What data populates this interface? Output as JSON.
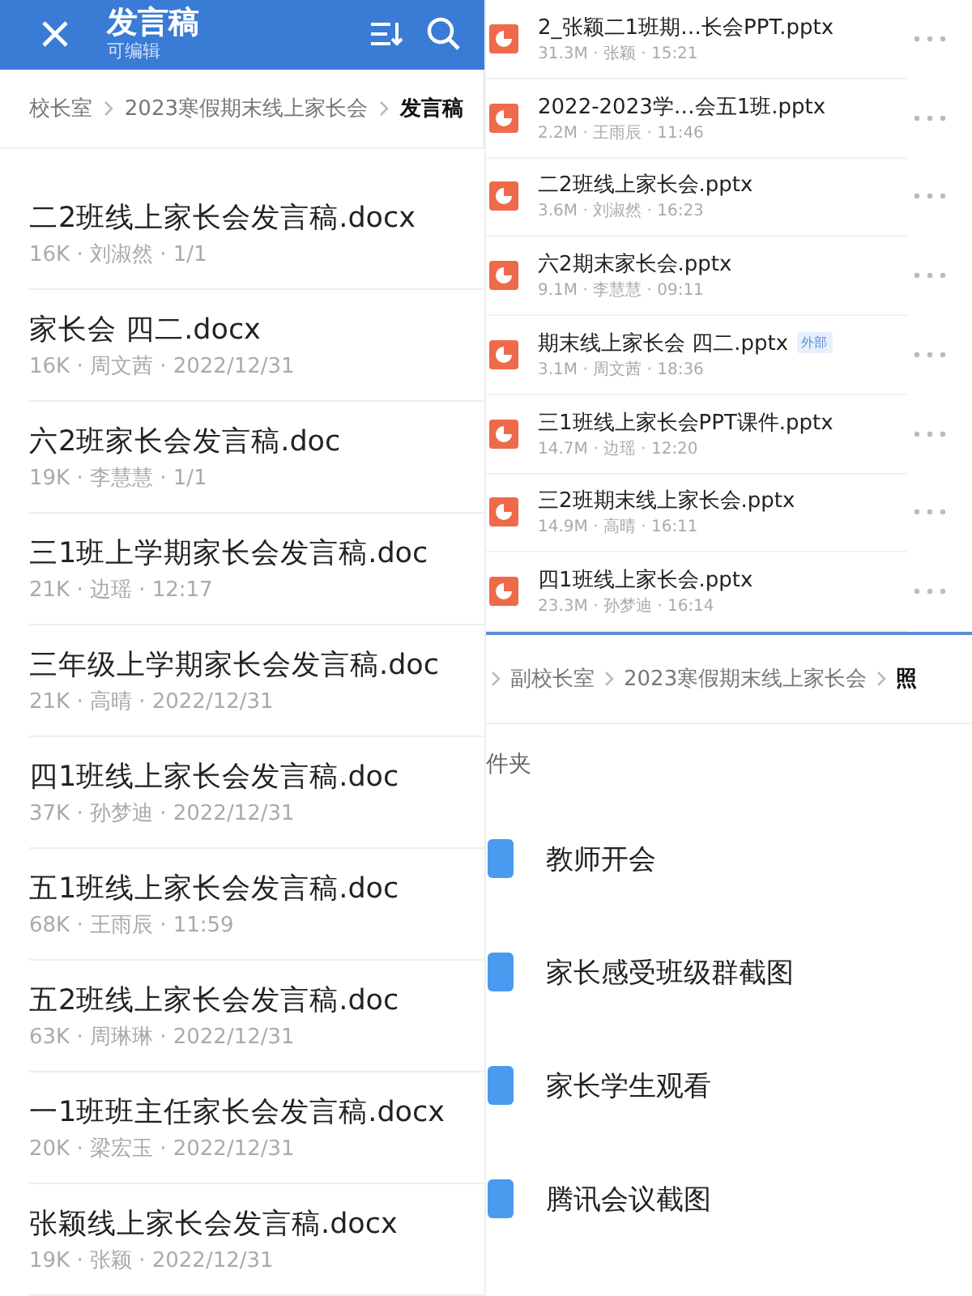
{
  "left_panel": {
    "header": {
      "title": "发言稿",
      "subtitle": "可编辑"
    },
    "breadcrumb": [
      {
        "label": "校长室",
        "current": false
      },
      {
        "label": "2023寒假期末线上家长会",
        "current": false
      },
      {
        "label": "发言稿",
        "current": true
      }
    ],
    "files": [
      {
        "name": "二2班线上家长会发言稿.docx",
        "meta": "16K · 刘淑然 · 1/1"
      },
      {
        "name": "家长会  四二.docx",
        "meta": "16K · 周文茜 · 2022/12/31"
      },
      {
        "name": "六2班家长会发言稿.doc",
        "meta": "19K · 李慧慧 · 1/1"
      },
      {
        "name": "三1班上学期家长会发言稿.doc",
        "meta": "21K · 边瑶 · 12:17"
      },
      {
        "name": "三年级上学期家长会发言稿.doc",
        "meta": "21K · 高晴 · 2022/12/31"
      },
      {
        "name": "四1班线上家长会发言稿.doc",
        "meta": "37K · 孙梦迪 · 2022/12/31"
      },
      {
        "name": "五1班线上家长会发言稿.doc",
        "meta": "68K · 王雨辰 · 11:59"
      },
      {
        "name": "五2班线上家长会发言稿.doc",
        "meta": "63K · 周琳琳 · 2022/12/31"
      },
      {
        "name": "一1班班主任家长会发言稿.docx",
        "meta": "20K · 梁宏玉 · 2022/12/31"
      },
      {
        "name": "张颖线上家长会发言稿.docx",
        "meta": "19K · 张颖 · 2022/12/31"
      }
    ]
  },
  "right_panel": {
    "files": [
      {
        "name": "2_张颖二1班期…长会PPT.pptx",
        "meta": "31.3M · 张颖 · 15:21"
      },
      {
        "name": "2022-2023学…会五1班.pptx",
        "meta": "2.2M · 王雨辰 · 11:46"
      },
      {
        "name": "二2班线上家长会.pptx",
        "meta": "3.6M · 刘淑然 · 16:23"
      },
      {
        "name": "六2期末家长会.pptx",
        "meta": "9.1M · 李慧慧 · 09:11"
      },
      {
        "name": "期末线上家长会  四二.pptx",
        "meta": "3.1M · 周文茜 · 18:36",
        "tag": "外部"
      },
      {
        "name": "三1班线上家长会PPT课件.pptx",
        "meta": "14.7M · 边瑶 · 12:20"
      },
      {
        "name": "三2班期末线上家长会.pptx",
        "meta": "14.9M · 高晴 · 16:11"
      },
      {
        "name": "四1班线上家长会.pptx",
        "meta": "23.3M · 孙梦迪 · 16:14"
      }
    ],
    "breadcrumb": [
      {
        "label": "副校长室",
        "current": false
      },
      {
        "label": "2023寒假期末线上家长会",
        "current": false
      },
      {
        "label": "照",
        "current": true
      }
    ],
    "section_label": "件夹",
    "folders": [
      {
        "name": "教师开会"
      },
      {
        "name": "家长感受班级群截图"
      },
      {
        "name": "家长学生观看"
      },
      {
        "name": "腾讯会议截图"
      }
    ]
  }
}
